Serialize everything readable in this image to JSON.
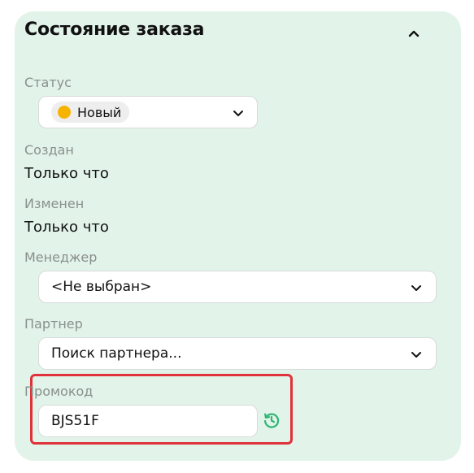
{
  "panel": {
    "title": "Состояние заказа",
    "collapse_icon": "chevron-up-icon"
  },
  "status": {
    "label": "Статус",
    "value": "Новый",
    "dot_color": "#f6b400"
  },
  "created": {
    "label": "Создан",
    "value": "Только что"
  },
  "modified": {
    "label": "Изменен",
    "value": "Только что"
  },
  "manager": {
    "label": "Менеджер",
    "value": "<Не выбран>"
  },
  "partner": {
    "label": "Партнер",
    "placeholder": "Поиск партнера..."
  },
  "promo": {
    "label": "Промокод",
    "value": "BJS51F",
    "history_icon": "history-icon"
  },
  "colors": {
    "panel_bg": "#e2f3ea",
    "highlight_border": "#e0323a",
    "history_icon": "#2bb673"
  }
}
